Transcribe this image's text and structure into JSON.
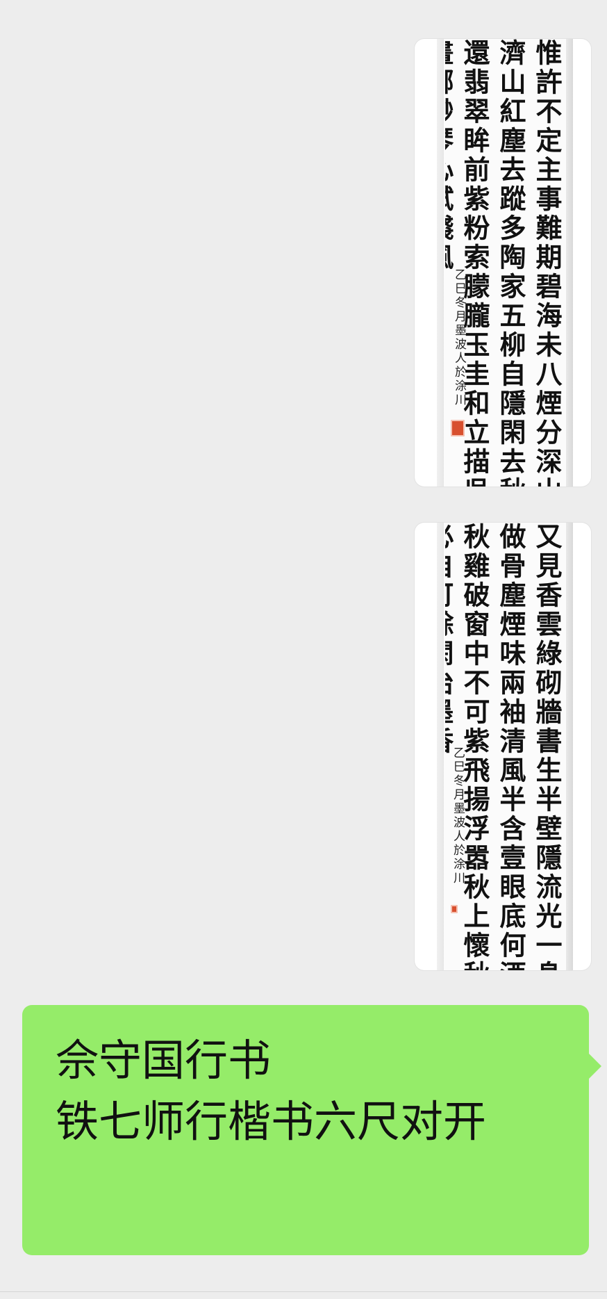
{
  "colors": {
    "background": "#ededed",
    "bubble_self": "#95ec69",
    "bubble_text": "#111111",
    "seal": "#d8502f"
  },
  "messages": [
    {
      "type": "image",
      "calligraphy": "惟許不定主事難期碧海未八煙分深山\n濟山紅塵去蹤多陶家五柳自隱閑去秋\n還翡翠眸前紫粉索朦朧玉圭和立描吳\n畫哪渺琴心試錢風",
      "colophon": "乙巳冬月墨波人於涂川"
    },
    {
      "type": "image",
      "calligraphy": "又見香雲綠砌牆書生半壁隱流光一身\n做骨塵煙味兩袖清風半含壹眼底何酒\n秋雞破窗中不可紫飛揚浮嚣秋上懷秋\n必自可餘閑治墨香",
      "colophon": "乙巳冬月墨波人於涂川"
    },
    {
      "type": "text",
      "text": "佘守国行书\n铁七师行楷书六尺对开"
    }
  ]
}
